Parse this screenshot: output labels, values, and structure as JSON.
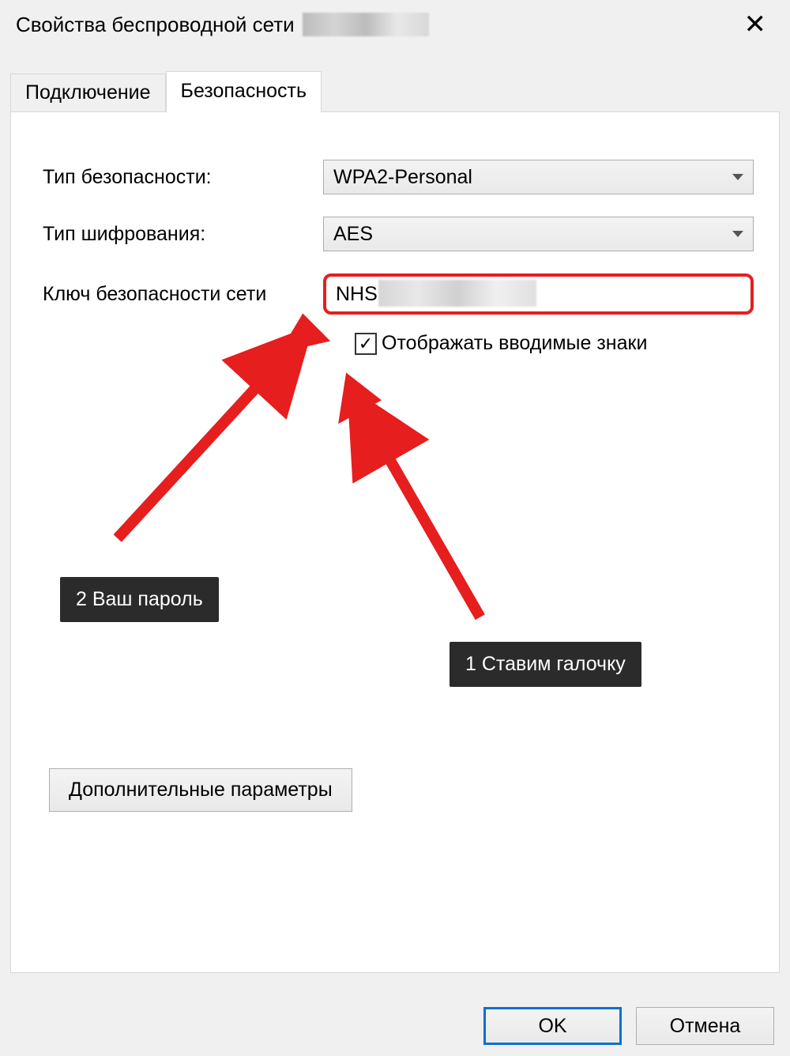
{
  "window": {
    "title": "Свойства беспроводной сети"
  },
  "tabs": {
    "connection": "Подключение",
    "security": "Безопасность"
  },
  "form": {
    "security_type_label": "Тип безопасности:",
    "security_type_value": "WPA2-Personal",
    "encryption_label": "Тип шифрования:",
    "encryption_value": "AES",
    "key_label": "Ключ безопасности сети",
    "key_value": "NHS",
    "show_chars_label": "Отображать вводимые знаки",
    "show_chars_checked": true,
    "advanced_button": "Дополнительные параметры"
  },
  "buttons": {
    "ok": "OK",
    "cancel": "Отмена"
  },
  "annotations": {
    "callout_1": "1 Ставим галочку",
    "callout_2": "2 Ваш пароль",
    "highlight_color": "#e61e1e"
  }
}
